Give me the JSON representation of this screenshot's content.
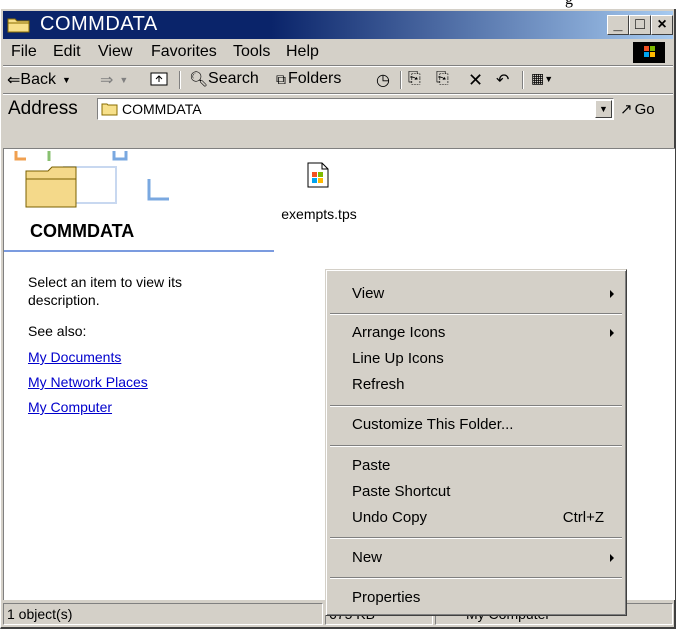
{
  "top_fragment": "g",
  "window": {
    "title": "COMMDATA",
    "controls": {
      "minimize": "_",
      "maximize": "□",
      "close": "×"
    }
  },
  "menubar": [
    "File",
    "Edit",
    "View",
    "Favorites",
    "Tools",
    "Help"
  ],
  "toolbar": {
    "back": "Back",
    "search": "Search",
    "folders": "Folders"
  },
  "address": {
    "label": "Address",
    "value": "COMMDATA",
    "go": "Go"
  },
  "left_panel": {
    "folder_title": "COMMDATA",
    "description": "Select an item to view its description.",
    "see_also": "See also:",
    "links": [
      "My Documents",
      "My Network Places",
      "My Computer"
    ]
  },
  "files": [
    {
      "name": "exempts.tps",
      "icon": "windows-document-icon"
    }
  ],
  "statusbar": {
    "objects": "1 object(s)",
    "size": "675 KB",
    "zone": "My Computer"
  },
  "context_menu": {
    "items": [
      {
        "label": "View",
        "submenu": true
      },
      {
        "label": "Arrange Icons",
        "submenu": true
      },
      {
        "label": "Line Up Icons"
      },
      {
        "label": "Refresh"
      },
      {
        "label": "Customize This Folder..."
      },
      {
        "label": "Paste"
      },
      {
        "label": "Paste Shortcut"
      },
      {
        "label": "Undo Copy",
        "shortcut": "Ctrl+Z"
      },
      {
        "label": "New",
        "submenu": true
      },
      {
        "label": "Properties"
      }
    ]
  },
  "colors": {
    "title_gradient_start": "#0a246a",
    "title_gradient_end": "#a6caf0",
    "chrome": "#d4d0c8",
    "link": "#0000cc"
  }
}
